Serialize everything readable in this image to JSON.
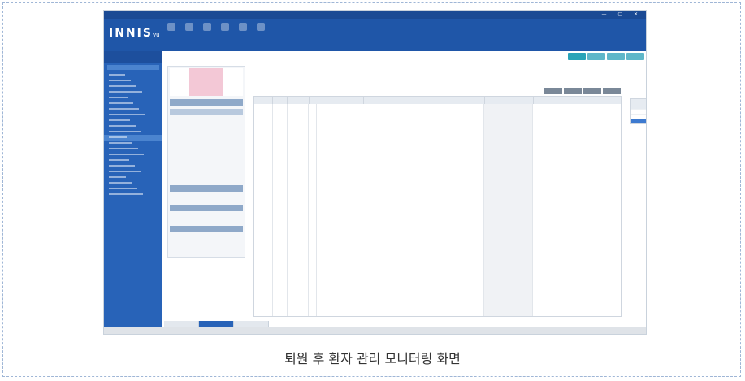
{
  "caption": "퇴원 후 환자 관리 모니터링 화면",
  "colors": {
    "header_blue": "#1f56a8",
    "sidebar_blue": "#2863b8",
    "accent_teal": "#2aa4b8",
    "patient_pink": "#f3c8d6",
    "selected_row": "#3d7ad0"
  },
  "app": {
    "logo": "INNIS",
    "logo_suffix": "vu",
    "window_controls": "— ▢ ✕"
  },
  "toolbar_icons": [
    "home-icon",
    "patient-icon",
    "calendar-icon",
    "document-icon",
    "print-icon",
    "settings-icon"
  ],
  "sidebar": {
    "rows": 22,
    "selected_index": 11
  },
  "content": {
    "tabs": 3,
    "active_tab": 1
  }
}
